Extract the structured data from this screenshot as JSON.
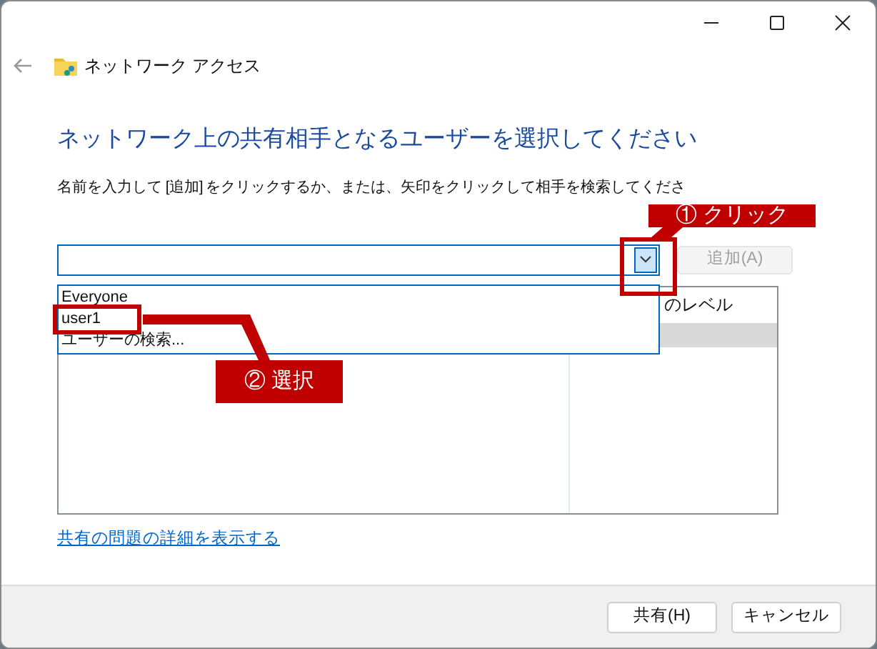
{
  "window": {
    "title": "ネットワーク アクセス"
  },
  "heading": "ネットワーク上の共有相手となるユーザーを選択してください",
  "instruction": "名前を入力して [追加] をクリックするか、または、矢印をクリックして相手を検索してくださ",
  "combo": {
    "expanded": true,
    "options": [
      {
        "label": "Everyone",
        "selected": false
      },
      {
        "label": "user1",
        "selected": false
      },
      {
        "label": "ユーザーの検索...",
        "selected": false
      }
    ]
  },
  "add_button": {
    "label": "追加(A)",
    "disabled": true
  },
  "list": {
    "column_2": "のレベル",
    "rows": [
      {
        "selected": true
      }
    ]
  },
  "link": "共有の問題の詳細を表示する",
  "buttons": [
    "共有(H)",
    "キャンセル"
  ],
  "annotations": [
    {
      "text": "① クリック"
    },
    {
      "text": "② 選択"
    }
  ]
}
